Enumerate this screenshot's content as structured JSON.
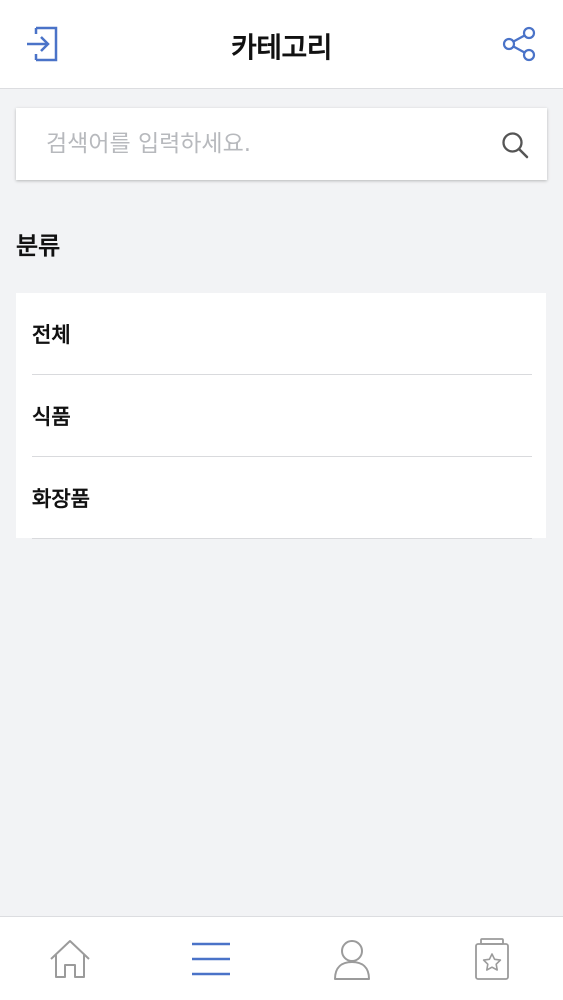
{
  "header": {
    "title": "카테고리",
    "left_icon": "login-icon",
    "right_icon": "share-icon"
  },
  "search": {
    "placeholder": "검색어를 입력하세요.",
    "value": "",
    "icon": "search-icon"
  },
  "section": {
    "title": "분류"
  },
  "categories": [
    {
      "label": "전체"
    },
    {
      "label": "식품"
    },
    {
      "label": "화장품"
    }
  ],
  "tabbar": {
    "items": [
      {
        "icon": "home-icon",
        "active": false
      },
      {
        "icon": "menu-icon",
        "active": true
      },
      {
        "icon": "user-icon",
        "active": false
      },
      {
        "icon": "favorites-icon",
        "active": false
      }
    ]
  },
  "colors": {
    "accent": "#4a73c8",
    "inactive_icon": "#9b9b9b",
    "background": "#f2f3f5"
  }
}
